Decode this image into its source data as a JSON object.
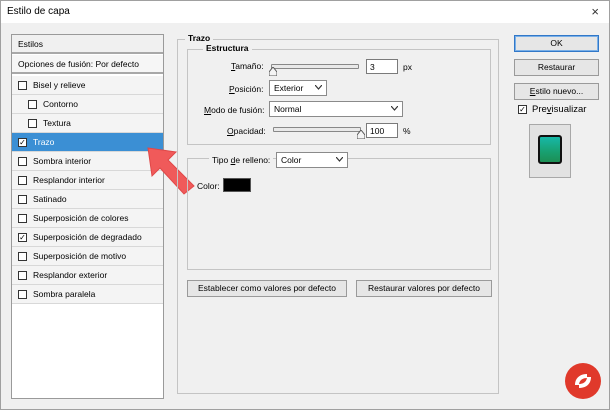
{
  "window": {
    "title": "Estilo de capa",
    "close_symbol": "×"
  },
  "styles_list": {
    "header": "Estilos",
    "blend_options": "Opciones de fusión: Por defecto",
    "items": [
      {
        "label": "Bisel y relieve",
        "checked": false,
        "indent": false
      },
      {
        "label": "Contorno",
        "checked": false,
        "indent": true
      },
      {
        "label": "Textura",
        "checked": false,
        "indent": true
      },
      {
        "label": "Trazo",
        "checked": true,
        "indent": false,
        "selected": true
      },
      {
        "label": "Sombra interior",
        "checked": false,
        "indent": false
      },
      {
        "label": "Resplandor interior",
        "checked": false,
        "indent": false
      },
      {
        "label": "Satinado",
        "checked": false,
        "indent": false
      },
      {
        "label": "Superposición de colores",
        "checked": false,
        "indent": false
      },
      {
        "label": "Superposición de degradado",
        "checked": true,
        "indent": false
      },
      {
        "label": "Superposición de motivo",
        "checked": false,
        "indent": false
      },
      {
        "label": "Resplandor exterior",
        "checked": false,
        "indent": false
      },
      {
        "label": "Sombra paralela",
        "checked": false,
        "indent": false
      }
    ],
    "check_mark": "✓"
  },
  "stroke": {
    "legend": "Trazo",
    "structure_legend": "Estructura",
    "size": {
      "label_u": "T",
      "label_rest": "amaño:",
      "value": "3",
      "unit": "px",
      "slider_fraction": 0.02
    },
    "position": {
      "label_u": "P",
      "label_rest": "osición:",
      "value": "Exterior"
    },
    "blend_mode": {
      "label_u": "M",
      "label_rest": "odo de fusión:",
      "value": "Normal"
    },
    "opacity": {
      "label_u": "O",
      "label_rest": "pacidad:",
      "value": "100",
      "unit": "%",
      "slider_fraction": 1.0
    },
    "fill": {
      "label_pre": "Tipo ",
      "label_u": "d",
      "label_rest": "e relleno:",
      "type": "Color",
      "color_label": "Color:",
      "color_value": "#000000"
    },
    "make_default": "Establecer como valores por defecto",
    "reset_default": "Restaurar valores por defecto"
  },
  "buttons": {
    "ok": "OK",
    "reset": "Restaurar",
    "new_style_u": "E",
    "new_style_rest": "stilo nuevo...",
    "preview_pre": "Pre",
    "preview_u": "v",
    "preview_rest": "isualizar",
    "preview_checked": true
  },
  "colors": {
    "selection": "#3b8fd4",
    "arrow": "#f05a5a",
    "logo_red": "#e0392b"
  }
}
